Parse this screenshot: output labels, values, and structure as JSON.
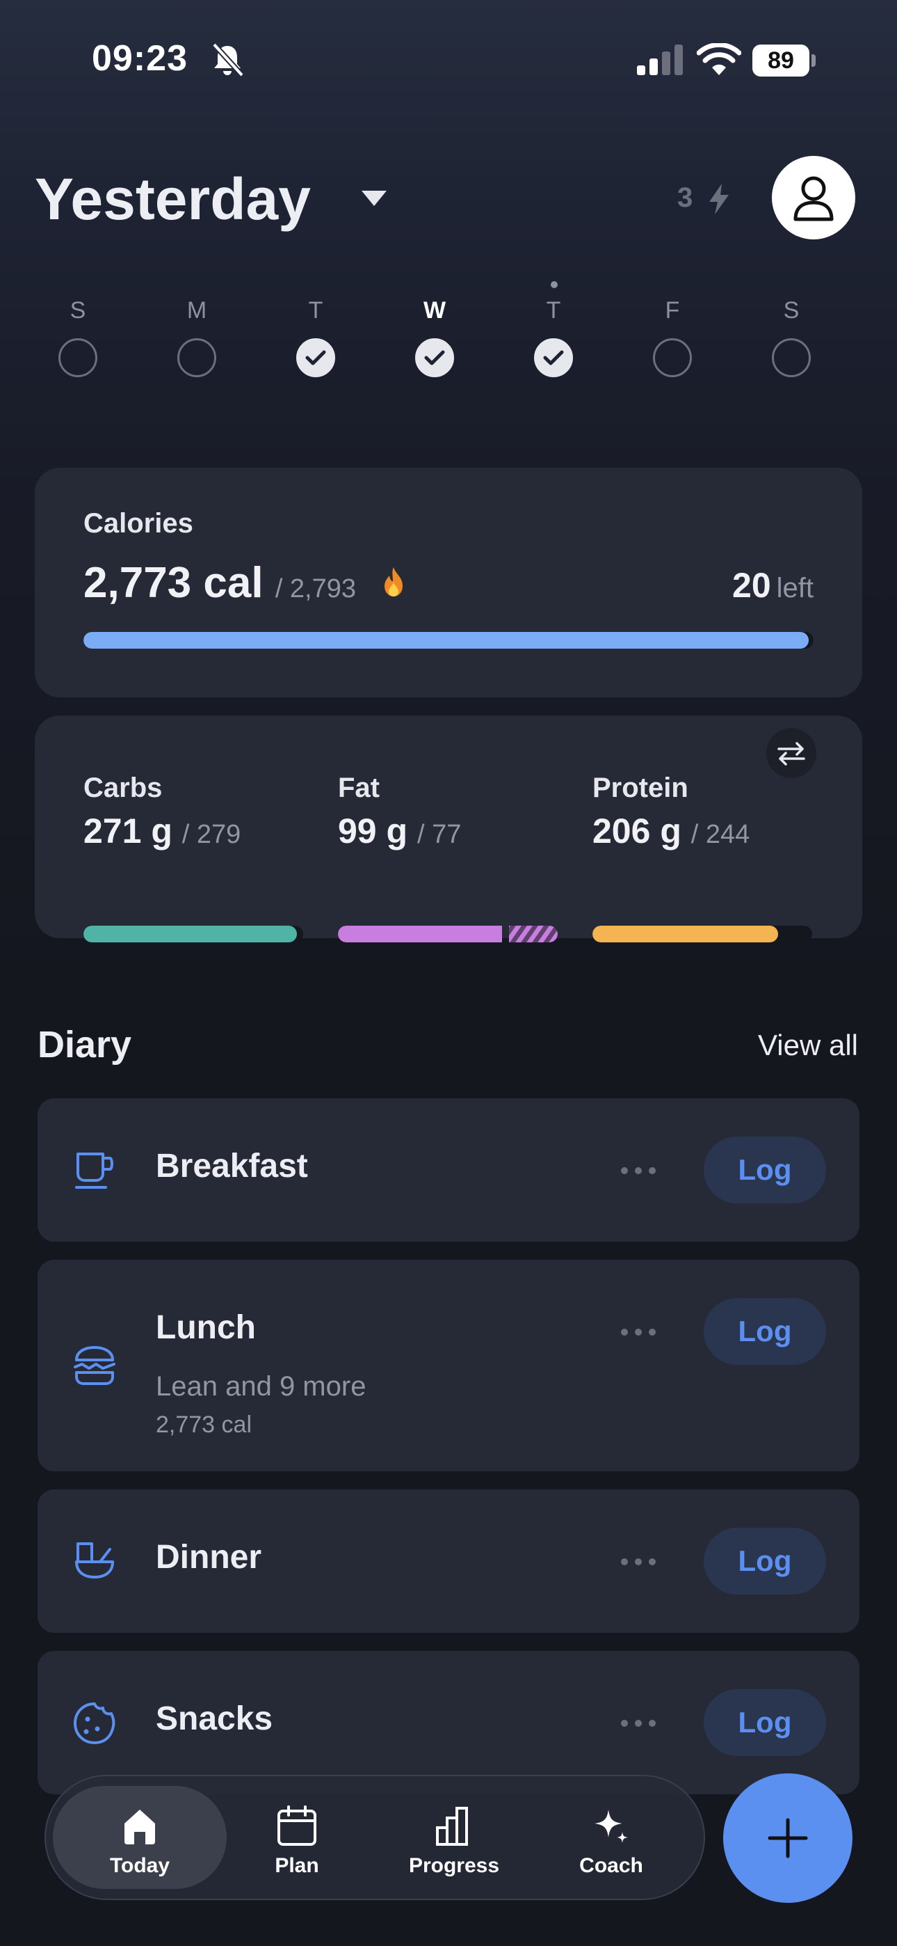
{
  "status_bar": {
    "time": "09:23",
    "battery": "89",
    "battery_level": 0.89
  },
  "header": {
    "title": "Yesterday",
    "streak_count": "3"
  },
  "week": [
    {
      "label": "S",
      "state": "empty"
    },
    {
      "label": "M",
      "state": "empty"
    },
    {
      "label": "T",
      "state": "done"
    },
    {
      "label": "W",
      "state": "done",
      "selected": true
    },
    {
      "label": "T",
      "state": "done",
      "today_dot": true
    },
    {
      "label": "F",
      "state": "empty"
    },
    {
      "label": "S",
      "state": "empty"
    }
  ],
  "calories": {
    "label": "Calories",
    "value": "2,773 cal",
    "goal": "/ 2,793",
    "left_value": "20",
    "left_label": "left",
    "progress": 0.993,
    "color": "#7aadf5"
  },
  "macros": [
    {
      "name": "Carbs",
      "value": "271 g",
      "goal": "/ 279",
      "progress": 0.971,
      "color": "#4fb3a5",
      "over": false
    },
    {
      "name": "Fat",
      "value": "99 g",
      "goal": "/ 77",
      "progress": 1.0,
      "over_fraction": 0.222,
      "color": "#c77ede",
      "over": true
    },
    {
      "name": "Protein",
      "value": "206 g",
      "goal": "/ 244",
      "progress": 0.844,
      "color": "#f3b451",
      "over": false
    }
  ],
  "diary": {
    "title": "Diary",
    "view_all": "View all",
    "meals": [
      {
        "name": "Breakfast",
        "icon": "cup-icon",
        "log": "Log"
      },
      {
        "name": "Lunch",
        "icon": "burger-icon",
        "subtitle": "Lean and 9 more",
        "calories": "2,773 cal",
        "log": "Log"
      },
      {
        "name": "Dinner",
        "icon": "bowl-icon",
        "log": "Log"
      },
      {
        "name": "Snacks",
        "icon": "cookie-icon",
        "log": "Log"
      }
    ]
  },
  "nav": {
    "items": [
      {
        "label": "Today",
        "icon": "home-icon",
        "active": true
      },
      {
        "label": "Plan",
        "icon": "calendar-icon"
      },
      {
        "label": "Progress",
        "icon": "bar-chart-icon"
      },
      {
        "label": "Coach",
        "icon": "sparkle-icon"
      }
    ]
  },
  "accent": "#5b8ff0"
}
